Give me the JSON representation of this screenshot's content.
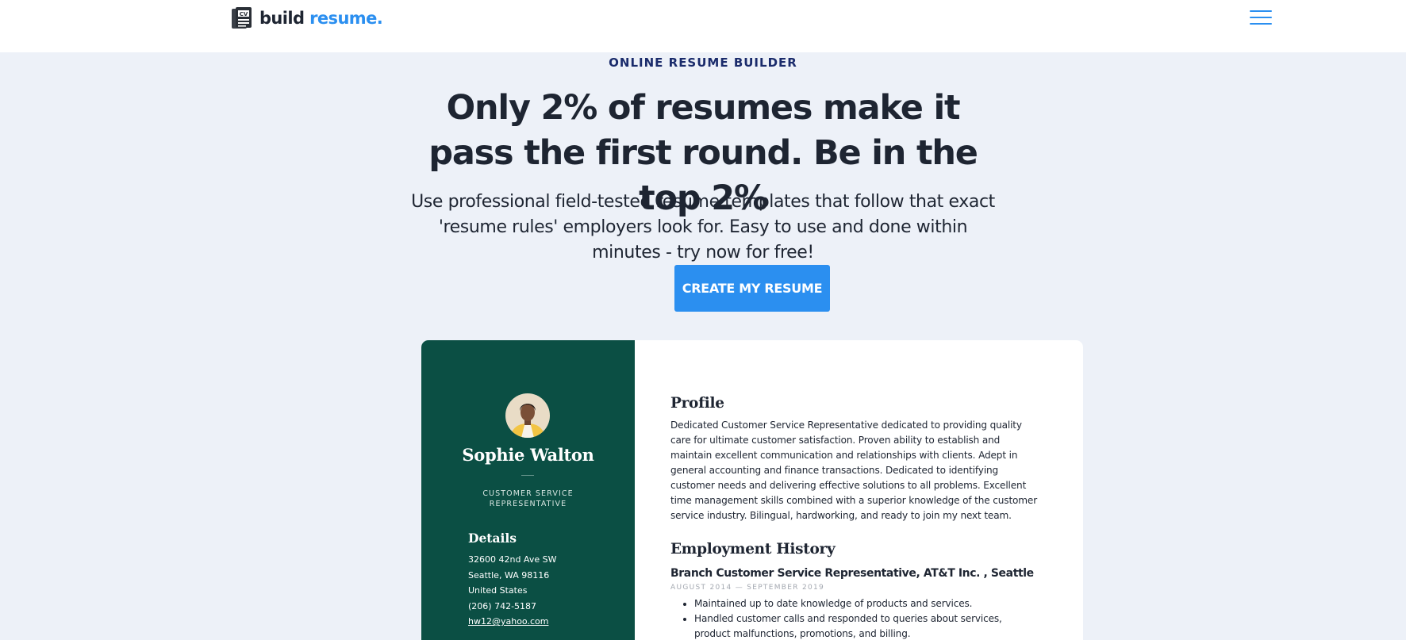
{
  "header": {
    "logo_main": "build",
    "logo_accent": "resume.",
    "logo_icon_text": "CV"
  },
  "hero": {
    "eyebrow": "ONLINE RESUME BUILDER",
    "headline": "Only 2% of resumes make it pass the first round. Be in the top 2%",
    "subtext": "Use professional field-tested resume templates that follow that exact 'resume rules' employers look for. Easy to use and done within minutes - try now for free!",
    "cta_label": "CREATE MY RESUME"
  },
  "resume": {
    "name": "Sophie Walton",
    "title": "CUSTOMER SERVICE REPRESENTATIVE",
    "details_heading": "Details",
    "details": {
      "address1": "32600 42nd Ave SW",
      "address2": "Seattle, WA 98116",
      "country": "United States",
      "phone": "(206) 742-5187",
      "email": "hw12@yahoo.com"
    },
    "profile_heading": "Profile",
    "profile_text": "Dedicated Customer Service Representative dedicated to providing quality care for ultimate customer satisfaction. Proven ability to establish and maintain excellent communication and relationships with clients. Adept in general accounting and finance transactions. Dedicated to identifying customer needs and delivering effective solutions to all problems. Excellent time management skills combined with a superior knowledge of the customer service industry. Bilingual, hardworking, and ready to join my next team.",
    "employment_heading": "Employment History",
    "job": {
      "title": "Branch Customer Service Representative, AT&T Inc. , Seattle",
      "dates": "AUGUST 2014 — SEPTEMBER 2019",
      "bullets": [
        "Maintained up to date knowledge of products and services.",
        "Handled customer calls and responded to queries about services, product malfunctions, promotions, and billing."
      ]
    }
  },
  "colors": {
    "accent": "#2b8ff0",
    "page_bg": "#edf1f8",
    "sidebar_green": "#0b4f44",
    "eyebrow_navy": "#1a2b6b"
  },
  "icons": {
    "logo": "cv-document-icon",
    "menu": "hamburger-menu-icon",
    "avatar": "profile-photo"
  }
}
